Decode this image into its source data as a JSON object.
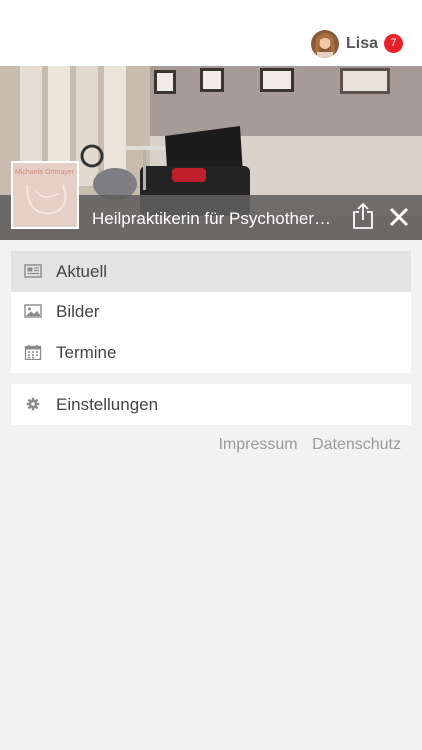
{
  "header": {
    "user_name": "Lisa",
    "notification_count": "7",
    "avatar_icon": "user-avatar"
  },
  "banner": {
    "logo_text": "Michaela Ortmayer",
    "title": "Heilpraktikerin für Psychotherapie",
    "share_icon": "share-icon",
    "close_icon": "close-icon"
  },
  "menu": {
    "items": [
      {
        "label": "Aktuell",
        "icon": "newspaper-icon",
        "active": true
      },
      {
        "label": "Bilder",
        "icon": "image-icon",
        "active": false
      },
      {
        "label": "Termine",
        "icon": "calendar-icon",
        "active": false
      }
    ],
    "settings": {
      "label": "Einstellungen",
      "icon": "gear-icon"
    }
  },
  "footer": {
    "impressum": "Impressum",
    "datenschutz": "Datenschutz"
  },
  "colors": {
    "badge": "#e8202a",
    "titlebar": "#5f5f5f",
    "active_item": "#e3e3e3",
    "background": "#f2f2f2"
  }
}
